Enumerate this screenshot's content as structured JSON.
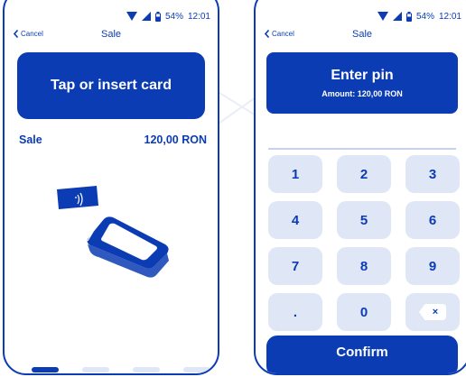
{
  "status_bar": {
    "battery_percent": "54%",
    "time": "12:01"
  },
  "left_screen": {
    "cancel_label": "Cancel",
    "title": "Sale",
    "prompt": "Tap or insert card",
    "sale_label": "Sale",
    "sale_amount": "120,00 RON",
    "icons": [
      "wifi-icon",
      "signal-icon",
      "battery-icon",
      "chevron-left-icon",
      "contactless-card-icon",
      "pos-terminal-icon"
    ],
    "pager": {
      "pages": 4,
      "active_page": 1
    }
  },
  "right_screen": {
    "cancel_label": "Cancel",
    "title": "Sale",
    "pin_title": "Enter pin",
    "amount_text": "Amount: 120,00 RON",
    "keys": [
      "1",
      "2",
      "3",
      "4",
      "5",
      "6",
      "7",
      "8",
      "9",
      ".",
      "0"
    ],
    "backspace_symbol": "×",
    "confirm_label": "Confirm"
  },
  "colors": {
    "brand_blue": "#0b3cb4",
    "key_background": "#dfe6f5",
    "white": "#ffffff"
  }
}
